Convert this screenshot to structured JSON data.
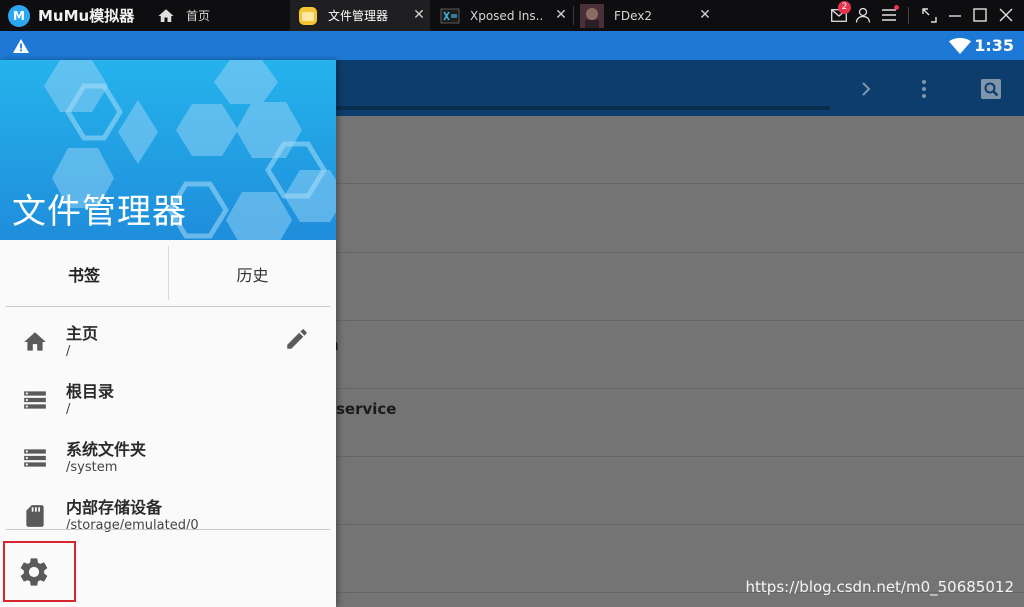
{
  "titlebar": {
    "app_name": "MuMu模拟器",
    "tabs": [
      {
        "label": "首页",
        "icon": "home-icon",
        "active": false
      },
      {
        "label": "文件管理器",
        "icon": "file-manager-app-icon",
        "active": true
      },
      {
        "label": "Xposed Ins..",
        "icon": "xposed-app-icon",
        "active": false
      },
      {
        "label": "FDex2",
        "icon": "fdex2-app-icon",
        "active": false
      }
    ],
    "mail_badge": "2"
  },
  "statusbar": {
    "time": "1:35"
  },
  "background_list": {
    "visible_fragments": [
      "n",
      "service"
    ]
  },
  "drawer": {
    "title": "文件管理器",
    "segments": [
      "书签",
      "历史"
    ],
    "items": [
      {
        "title": "主页",
        "path": "/",
        "icon": "home-icon"
      },
      {
        "title": "根目录",
        "path": "/",
        "icon": "storage-icon"
      },
      {
        "title": "系统文件夹",
        "path": "/system",
        "icon": "storage-icon"
      },
      {
        "title": "内部存储设备",
        "path": "/storage/emulated/0",
        "icon": "sd-card-icon"
      }
    ]
  },
  "watermark": "https://blog.csdn.net/m0_50685012",
  "colors": {
    "status_blue": "#1e79d6",
    "header_blue": "#2196e0",
    "highlight_red": "#d8262f"
  }
}
